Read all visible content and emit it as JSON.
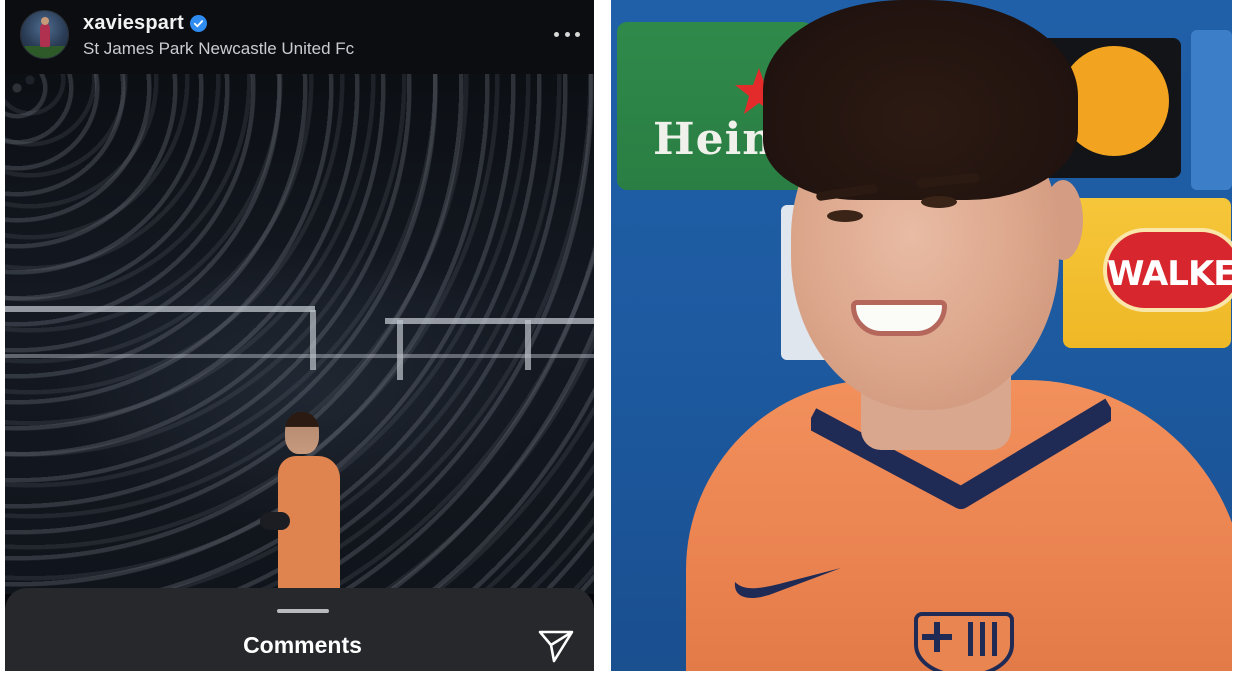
{
  "post": {
    "username": "xaviespart",
    "location": "St James Park Newcastle United Fc",
    "verified": true
  },
  "comments_sheet": {
    "title": "Comments"
  },
  "right_photo": {
    "sponsor_heineken": "Heine",
    "sponsor_walkers": "WALKER"
  },
  "colors": {
    "verified_badge": "#2f8cf0",
    "sheet_background": "#26282c",
    "shirt_orange": "#ea8350"
  },
  "icons": [
    "verified-badge-icon",
    "more-options-icon",
    "send-icon",
    "nike-swoosh-icon"
  ]
}
